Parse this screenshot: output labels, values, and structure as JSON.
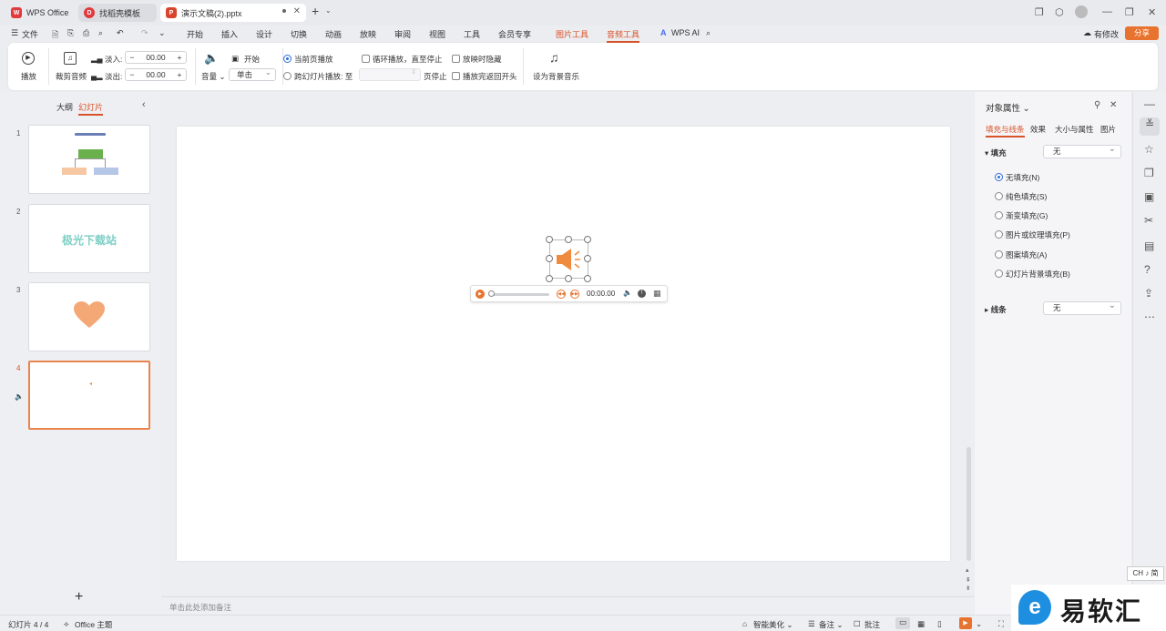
{
  "titlebar": {
    "tabs": [
      {
        "label": "WPS Office"
      },
      {
        "label": "找稻壳模板"
      },
      {
        "label": "演示文稿(2).pptx"
      }
    ],
    "new_tab": "+"
  },
  "menu": {
    "file": "文件",
    "items": [
      "开始",
      "插入",
      "设计",
      "切换",
      "动画",
      "放映",
      "审阅",
      "视图",
      "工具",
      "会员专享"
    ],
    "picture_tools": "图片工具",
    "audio_tools": "音频工具",
    "wps_ai": "WPS AI",
    "has_changes": "有修改",
    "share": "分享"
  },
  "ribbon": {
    "play": "播放",
    "trim": "裁剪音频",
    "fade_in": "淡入:",
    "fade_out": "淡出:",
    "fade_in_value": "00.00",
    "fade_out_value": "00.00",
    "volume": "音量",
    "start": "开始",
    "start_mode": "单击",
    "current_page": "当前页播放",
    "cross_slides": "跨幻灯片播放: 至",
    "page_stop": "页停止",
    "loop": "循环播放，直至停止",
    "hide": "放映时隐藏",
    "rewind": "播放完返回开头",
    "set_bg_music": "设为背景音乐"
  },
  "leftpanel": {
    "outline": "大纲",
    "slides": "幻灯片",
    "numbers": [
      "1",
      "2",
      "3",
      "4"
    ],
    "thumb2_text": "极光下载站",
    "add": "+"
  },
  "audio_player": {
    "time": "00:00.00"
  },
  "notes": {
    "placeholder": "单击此处添加备注"
  },
  "rightpanel": {
    "title": "对象属性",
    "tabs": [
      "填充与线条",
      "效果",
      "大小与属性",
      "图片"
    ],
    "fill_label": "填充",
    "fill_value": "无",
    "options": [
      "无填充(N)",
      "纯色填充(S)",
      "渐变填充(G)",
      "图片或纹理填充(P)",
      "图案填充(A)",
      "幻灯片背景填充(B)"
    ],
    "line_label": "线条",
    "line_value": "无"
  },
  "statusbar": {
    "slide_count": "幻灯片 4 / 4",
    "theme": "Office 主题",
    "beautify": "智能美化",
    "notes": "备注",
    "comments": "批注"
  },
  "ime": {
    "label": "CH ♪ 简"
  },
  "watermark": {
    "text": "易软汇"
  },
  "colors": {
    "accent": "#d9532a",
    "brand_red": "#e0393e",
    "audio_orange": "#f08a3c",
    "thumb_border_selected": "#e8854f"
  }
}
